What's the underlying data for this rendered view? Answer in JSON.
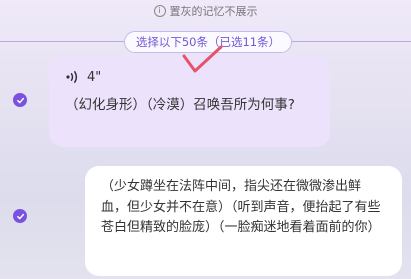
{
  "header": {
    "notice_icon": "info-icon",
    "notice_text": "置灰的记忆不展示"
  },
  "selection": {
    "label": "选择以下50条（已选11条）"
  },
  "messages": [
    {
      "role": "user",
      "selected": true,
      "voice_duration": "4\"",
      "text": "（幻化身形）（冷漠）召唤吾所为何事?"
    },
    {
      "role": "assistant",
      "selected": true,
      "text": "（少女蹲坐在法阵中间，指尖还在微微渗出鲜血，但少女并不在意）（听到声音，便抬起了有些苍白但精致的脸庞）（一脸痴迷地看着面前的你）"
    }
  ],
  "colors": {
    "accent": "#7a52e0",
    "annotation": "#e5536a",
    "user_bubble": "#ece2fb",
    "assistant_bubble": "#ffffff"
  }
}
